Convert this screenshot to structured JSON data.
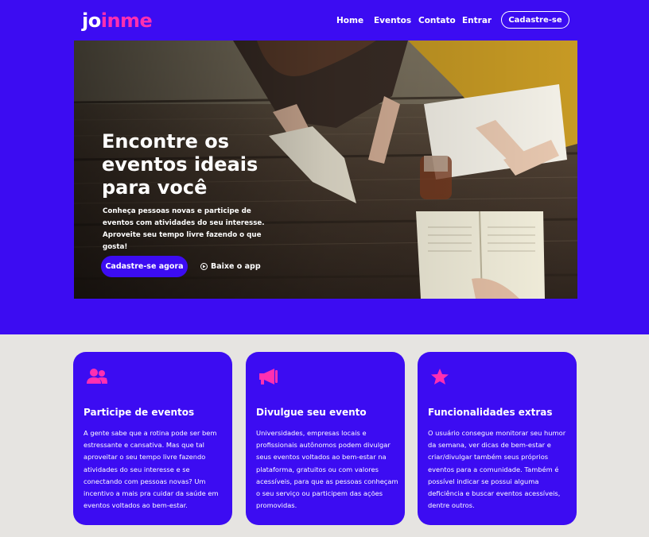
{
  "colors": {
    "primary": "#3c0cf2",
    "accent": "#ff2fb1",
    "page_bg": "#e6e4e1"
  },
  "brand": {
    "logo_part1": "jo",
    "logo_part2": "in",
    "logo_part3": "me"
  },
  "nav": {
    "items": [
      "Home",
      "Eventos",
      "Contato",
      "Entrar"
    ],
    "signup_label": "Cadastre-se"
  },
  "hero": {
    "title": "Encontre os eventos ideais para você",
    "text": "Conheça pessoas novas e participe de eventos com atividades do seu interesse. Aproveite seu tempo livre fazendo o que gosta!",
    "cta_label": "Cadastre-se agora",
    "app_label": "Baixe o app"
  },
  "features": [
    {
      "icon": "users-icon",
      "title": "Participe de eventos",
      "text": "A  gente sabe que a rotina pode ser bem estressante e cansativa. Mas que tal aproveitar o seu tempo livre fazendo atividades do seu interesse e se conectando com pessoas novas? Um incentivo a mais pra cuidar da saúde em eventos voltados ao bem-estar."
    },
    {
      "icon": "megaphone-icon",
      "title": "Divulgue seu evento",
      "text": "Universidades, empresas locais e profissionais autônomos podem divulgar seus eventos voltados ao bem-estar na plataforma, gratuitos ou com valores acessíveis, para que as pessoas conheçam o seu serviço ou participem das ações promovidas."
    },
    {
      "icon": "star-icon",
      "title": "Funcionalidades extras",
      "text": "O usuário consegue monitorar seu humor da semana, ver dicas de bem-estar e criar/divulgar também seus próprios eventos para a comunidade. Também é possível indicar se possui alguma deficiência e buscar eventos acessíveis, dentre outros."
    }
  ]
}
